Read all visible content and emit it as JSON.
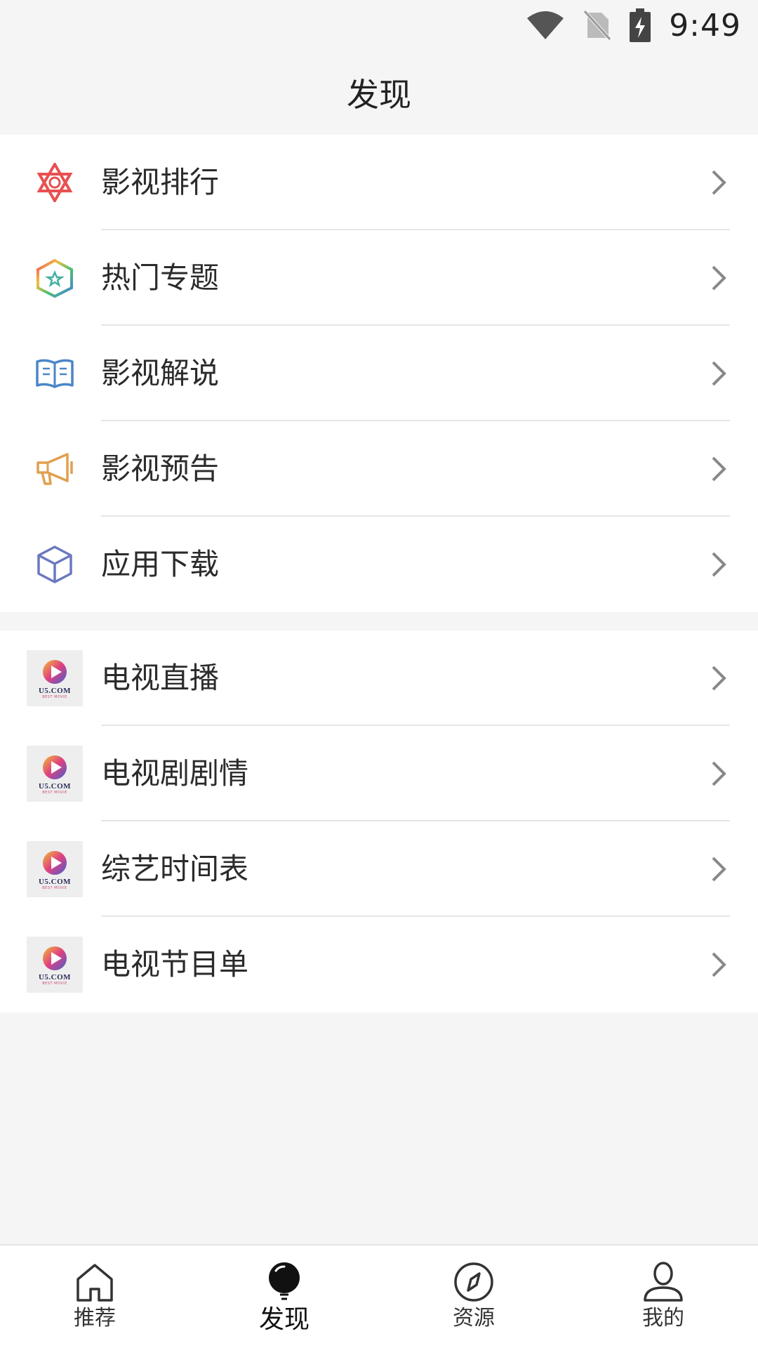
{
  "status_bar": {
    "time": "9:49"
  },
  "header": {
    "title": "发现"
  },
  "group1": [
    {
      "label": "影视排行",
      "icon": "star-of-david-icon",
      "color": "#e85050"
    },
    {
      "label": "热门专题",
      "icon": "rainbow-hexagon-star-icon",
      "color": "#3aa0e0"
    },
    {
      "label": "影视解说",
      "icon": "open-book-icon",
      "color": "#4a86c8"
    },
    {
      "label": "影视预告",
      "icon": "megaphone-icon",
      "color": "#e0a050"
    },
    {
      "label": "应用下载",
      "icon": "cube-icon",
      "color": "#6a78c0"
    }
  ],
  "group2": [
    {
      "label": "电视直播",
      "logo_text": "U5.COM",
      "logo_sub": "BEST MOVIE"
    },
    {
      "label": "电视剧剧情",
      "logo_text": "U5.COM",
      "logo_sub": "BEST MOVIE"
    },
    {
      "label": "综艺时间表",
      "logo_text": "U5.COM",
      "logo_sub": "BEST MOVIE"
    },
    {
      "label": "电视节目单",
      "logo_text": "U5.COM",
      "logo_sub": "BEST MOVIE"
    }
  ],
  "bottom_nav": [
    {
      "label": "推荐",
      "icon": "home-icon"
    },
    {
      "label": "发现",
      "icon": "lightbulb-icon",
      "active": true
    },
    {
      "label": "资源",
      "icon": "compass-icon"
    },
    {
      "label": "我的",
      "icon": "user-icon"
    }
  ]
}
